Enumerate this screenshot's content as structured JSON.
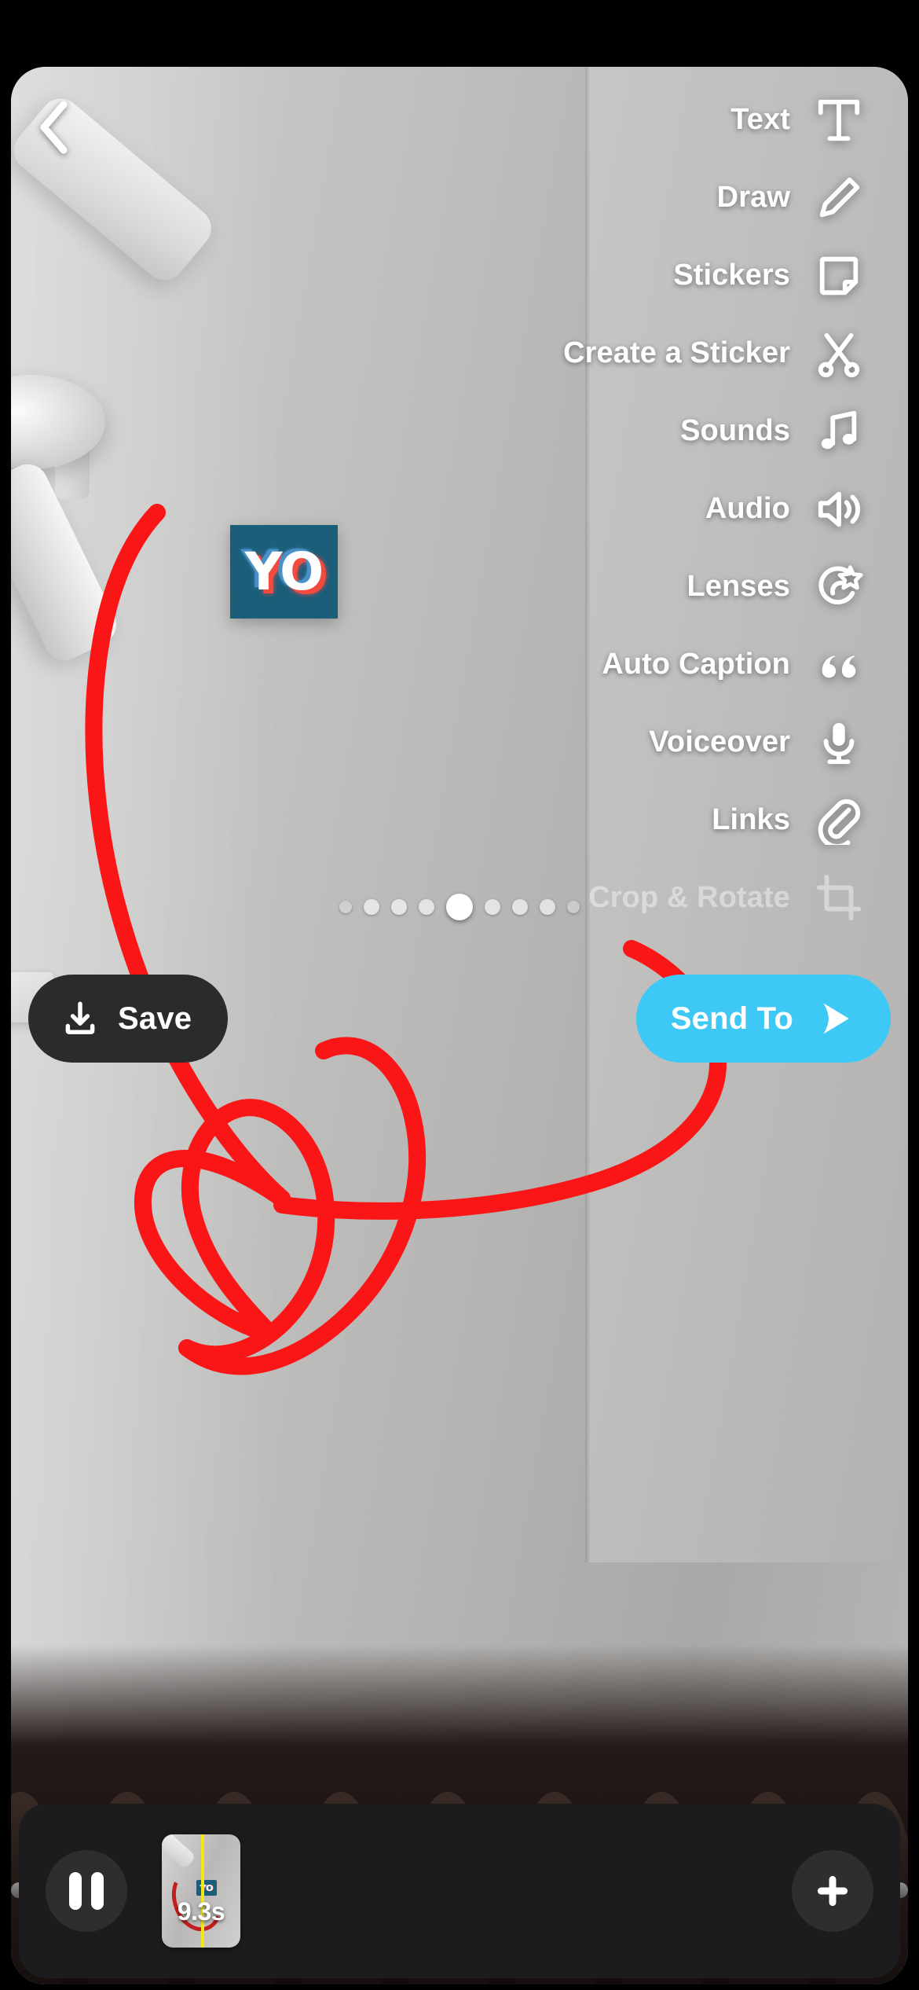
{
  "app": {
    "screen_name": "Snap Editor Preview"
  },
  "nav": {
    "back_icon": "chevron-left-icon"
  },
  "tools": {
    "items": [
      {
        "label": "Text",
        "icon": "text-icon",
        "dimmed": false
      },
      {
        "label": "Draw",
        "icon": "pencil-icon",
        "dimmed": false
      },
      {
        "label": "Stickers",
        "icon": "sticker-icon",
        "dimmed": false
      },
      {
        "label": "Create a Sticker",
        "icon": "scissors-icon",
        "dimmed": false
      },
      {
        "label": "Sounds",
        "icon": "music-note-icon",
        "dimmed": false
      },
      {
        "label": "Audio",
        "icon": "speaker-icon",
        "dimmed": false
      },
      {
        "label": "Lenses",
        "icon": "lens-star-icon",
        "dimmed": false
      },
      {
        "label": "Auto Caption",
        "icon": "quote-icon",
        "dimmed": false
      },
      {
        "label": "Voiceover",
        "icon": "microphone-icon",
        "dimmed": false
      },
      {
        "label": "Links",
        "icon": "paperclip-icon",
        "dimmed": false
      },
      {
        "label": "Crop & Rotate",
        "icon": "crop-icon",
        "dimmed": true
      }
    ]
  },
  "overlay": {
    "sticker_text": "YO",
    "sticker_bg_color": "#1a5e7a",
    "draw_color": "#fa1616"
  },
  "pager": {
    "total_dots": 9,
    "active_index": 4
  },
  "actions": {
    "save_label": "Save",
    "save_icon": "download-icon",
    "send_to_label": "Send To",
    "send_to_icon": "send-arrow-icon",
    "send_to_color": "#3ec8f5"
  },
  "timeline": {
    "play_pause_icon": "pause-icon",
    "clip_duration": "9.3s",
    "clip_sticker_text": "YO",
    "playhead_color": "#f2e818",
    "add_icon": "plus-icon"
  }
}
